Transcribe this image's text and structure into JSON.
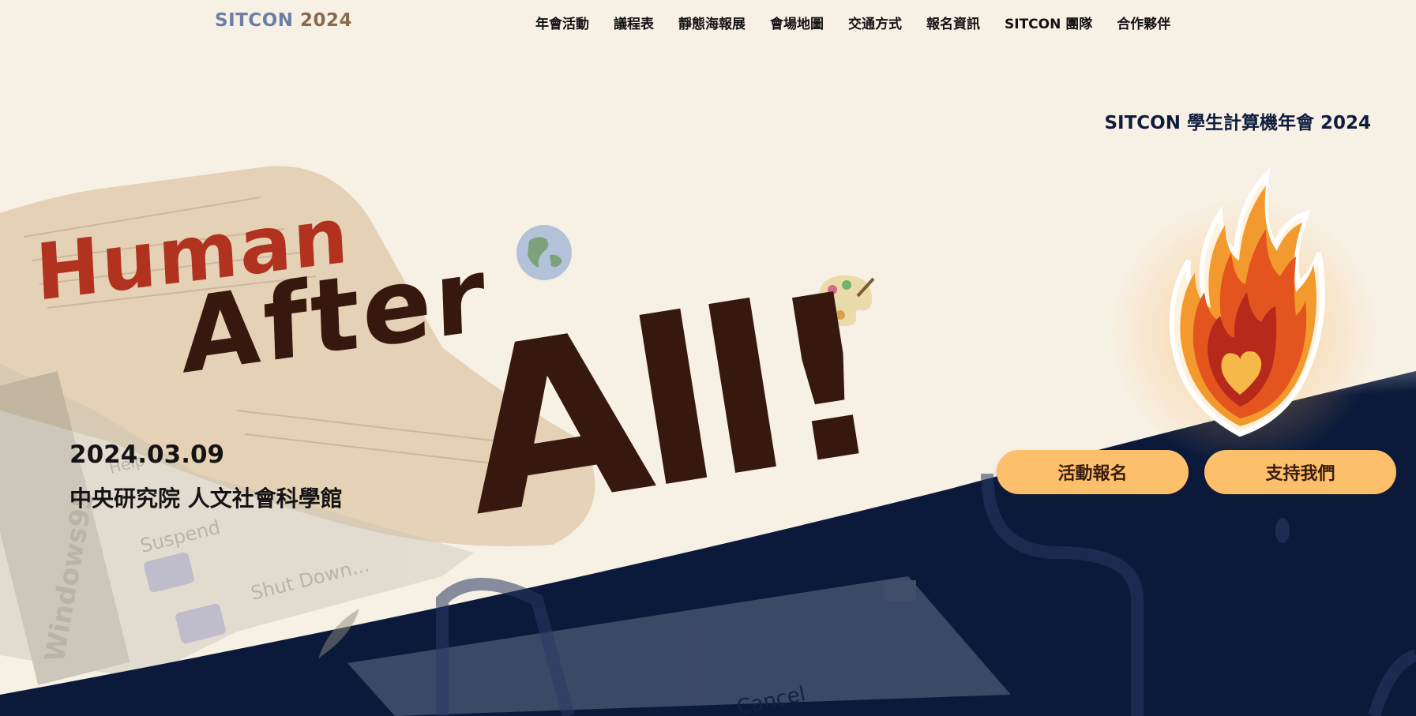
{
  "brand": {
    "part1": "SITCON",
    "part2": "2024"
  },
  "nav": {
    "items": [
      {
        "label": "年會活動"
      },
      {
        "label": "議程表"
      },
      {
        "label": "靜態海報展"
      },
      {
        "label": "會場地圖"
      },
      {
        "label": "交通方式"
      },
      {
        "label": "報名資訊"
      },
      {
        "label": "SITCON 團隊"
      },
      {
        "label": "合作夥伴"
      }
    ]
  },
  "hero": {
    "event_name": "SITCON 學生計算機年會 2024",
    "title": {
      "line1": "Human",
      "line2": "After",
      "line3": "All!"
    },
    "date": "2024.03.09",
    "venue": "中央研究院 人文社會科學館",
    "buttons": {
      "register": "活動報名",
      "support": "支持我們"
    }
  },
  "colors": {
    "background": "#f7f0e4",
    "navy": "#0b1a3b",
    "title_red": "#b1331f",
    "title_brown": "#36180f",
    "button": "#fcbf6b"
  },
  "icons": [
    "globe-icon",
    "paint-palette-icon",
    "flame-heart-icon",
    "feather-icon"
  ]
}
